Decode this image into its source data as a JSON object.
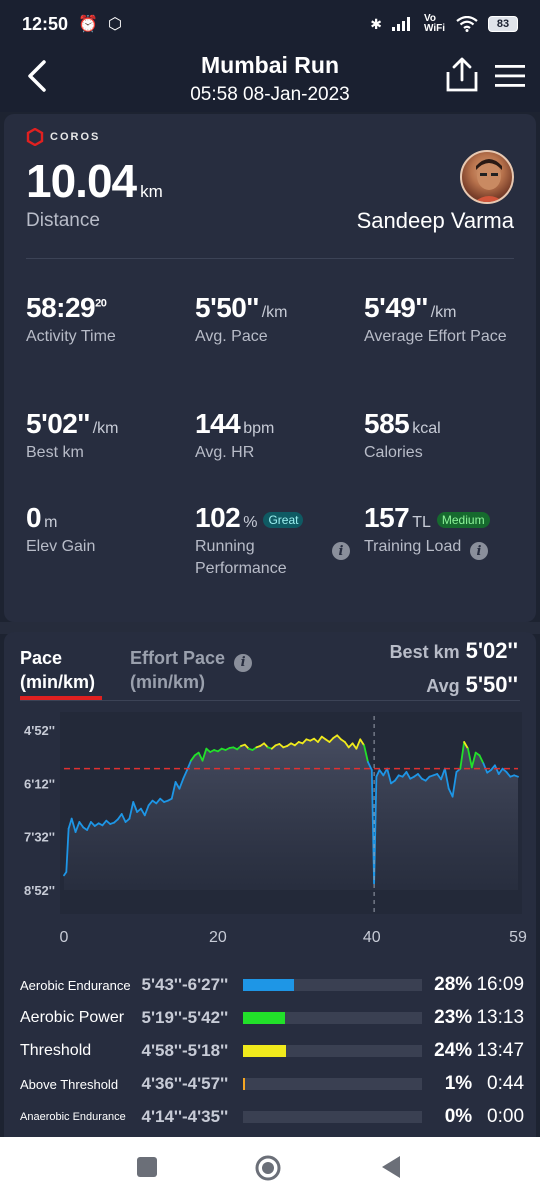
{
  "status_bar": {
    "time": "12:50",
    "network": "Vo WiFi",
    "battery": "83"
  },
  "header": {
    "title": "Mumbai Run",
    "subtitle": "05:58 08-Jan-2023"
  },
  "summary": {
    "brand": "COROS",
    "distance_value": "10.04",
    "distance_unit": "km",
    "distance_label": "Distance",
    "user_name": "Sandeep Varma",
    "metrics": [
      {
        "value": "58:29",
        "sup": "20",
        "unit": "",
        "label": "Activity Time"
      },
      {
        "value": "5'50''",
        "unit": "/km",
        "label": "Avg. Pace"
      },
      {
        "value": "5'49''",
        "unit": "/km",
        "label": "Average Effort Pace"
      },
      {
        "value": "5'02''",
        "unit": "/km",
        "label": "Best km"
      },
      {
        "value": "144",
        "unit": "bpm",
        "label": "Avg. HR"
      },
      {
        "value": "585",
        "unit": "kcal",
        "label": "Calories"
      },
      {
        "value": "0",
        "unit": "m",
        "label": "Elev Gain"
      },
      {
        "value": "102",
        "unit": "%",
        "badge": "Great",
        "label": "Running Performance"
      },
      {
        "value": "157",
        "unit": "TL",
        "badge": "Medium",
        "label": "Training Load"
      }
    ]
  },
  "chart_panel": {
    "tabs": [
      {
        "label": "Pace",
        "sub": "(min/km)",
        "active": true
      },
      {
        "label": "Effort Pace",
        "sub": "(min/km)",
        "active": false
      }
    ],
    "best_label": "Best km",
    "best_value": "5'02''",
    "avg_label": "Avg",
    "avg_value": "5'50''"
  },
  "chart_data": {
    "type": "line",
    "title": "",
    "xlabel": "",
    "ylabel": "",
    "x_ticks": [
      "0",
      "20",
      "40",
      "59"
    ],
    "y_ticks": [
      "4'52''",
      "6'12''",
      "7'32''",
      "8'52''"
    ],
    "xlim": [
      0,
      59
    ],
    "ylim_seconds": [
      292,
      532
    ],
    "avg_line_seconds": 350,
    "zone_colors": {
      "aerobic_endurance": "#1e96e6",
      "aerobic_power": "#22e02a",
      "threshold": "#f0ea1c"
    },
    "series": [
      {
        "x": [
          0,
          0.3,
          0.6,
          1,
          1.5,
          2,
          2.5,
          3,
          3.5,
          4,
          4.5,
          5,
          5.5,
          6,
          6.5,
          7,
          7.5,
          8,
          8.5,
          9,
          9.5,
          10,
          10.5,
          11,
          11.5,
          12,
          12.5,
          13,
          13.5,
          14,
          14.5,
          15,
          15.5,
          16,
          16.5,
          17,
          17.5,
          18,
          18.5,
          19,
          19.5,
          20,
          20.5,
          21,
          21.5,
          22,
          22.5,
          23,
          23.5,
          24,
          24.5,
          25,
          25.5,
          26,
          26.5,
          27,
          27.5,
          28,
          28.5,
          29,
          29.5,
          30,
          30.5,
          31,
          31.5,
          32,
          32.5,
          33,
          33.5,
          34,
          34.5,
          35,
          35.5,
          36,
          36.5,
          37,
          37.5,
          38,
          38.5,
          39,
          39.5,
          40,
          40.3,
          40.6,
          41,
          41.5,
          42,
          42.5,
          43,
          43.5,
          44,
          44.5,
          45,
          45.5,
          46,
          46.5,
          47,
          47.5,
          48,
          48.5,
          49,
          49.5,
          50,
          50.5,
          51,
          51.5,
          52,
          52.5,
          53,
          53.5,
          54,
          54.5,
          55,
          55.5,
          56,
          56.5,
          57,
          57.5,
          58,
          58.5,
          59
        ],
        "y": [
          510,
          505,
          440,
          425,
          445,
          430,
          438,
          442,
          430,
          436,
          432,
          435,
          428,
          433,
          431,
          426,
          418,
          430,
          425,
          400,
          415,
          410,
          420,
          405,
          398,
          402,
          395,
          400,
          398,
          395,
          370,
          380,
          365,
          352,
          338,
          330,
          326,
          338,
          320,
          325,
          322,
          324,
          320,
          322,
          319,
          318,
          321,
          316,
          314,
          320,
          322,
          318,
          316,
          312,
          318,
          320,
          315,
          313,
          318,
          316,
          312,
          315,
          310,
          312,
          306,
          308,
          305,
          310,
          302,
          306,
          310,
          304,
          300,
          306,
          310,
          318,
          312,
          320,
          306,
          315,
          340,
          352,
          522,
          362,
          352,
          360,
          350,
          372,
          368,
          360,
          362,
          355,
          365,
          362,
          358,
          365,
          368,
          362,
          360,
          358,
          366,
          350,
          380,
          392,
          355,
          350,
          310,
          320,
          348,
          326,
          330,
          342,
          356,
          352,
          345,
          358,
          350,
          355,
          362,
          360,
          362
        ]
      }
    ]
  },
  "zones": [
    {
      "name": "Aerobic Endurance",
      "range": "5'43''-6'27''",
      "percent": 28,
      "pct_label": "28%",
      "time": "16:09",
      "color": "#1e96e6"
    },
    {
      "name": "Aerobic Power",
      "range": "5'19''-5'42''",
      "percent": 23,
      "pct_label": "23%",
      "time": "13:13",
      "color": "#22e02a"
    },
    {
      "name": "Threshold",
      "range": "4'58''-5'18''",
      "percent": 24,
      "pct_label": "24%",
      "time": "13:47",
      "color": "#f0ea1c"
    },
    {
      "name": "Above Threshold",
      "range": "4'36''-4'57''",
      "percent": 1,
      "pct_label": "1%",
      "time": "0:44",
      "color": "#f5a623"
    },
    {
      "name": "Anaerobic Endurance",
      "range": "4'14''-4'35''",
      "percent": 0,
      "pct_label": "0%",
      "time": "0:00",
      "color": "#e02020"
    }
  ]
}
